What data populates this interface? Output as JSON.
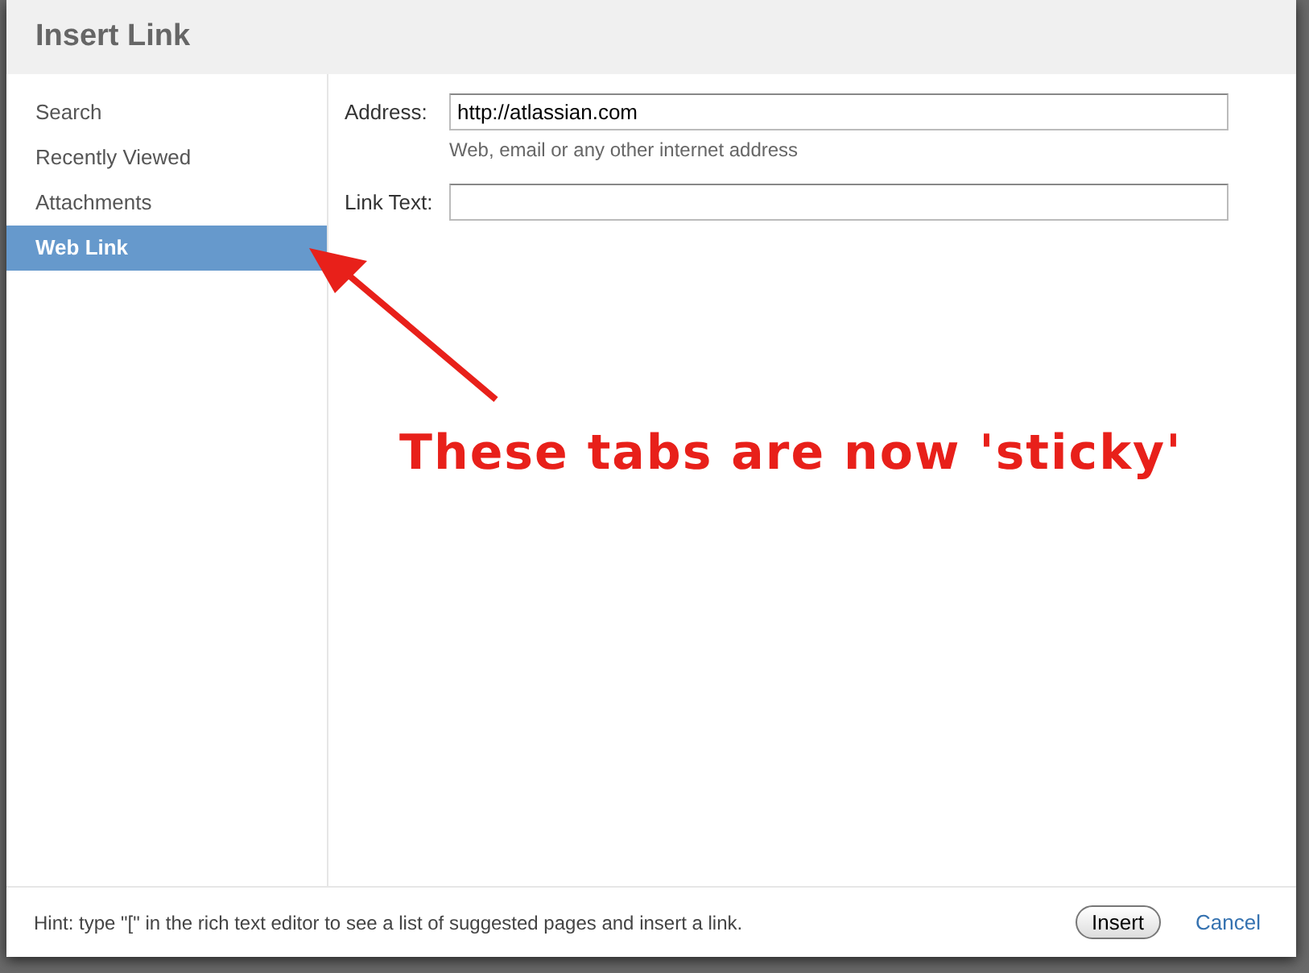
{
  "window": {
    "title": "Insert Link"
  },
  "tabs": [
    {
      "label": "Search",
      "selected": false
    },
    {
      "label": "Recently Viewed",
      "selected": false
    },
    {
      "label": "Attachments",
      "selected": false
    },
    {
      "label": "Web Link",
      "selected": true
    }
  ],
  "form": {
    "fields": [
      {
        "label": "Address:",
        "value": "http://atlassian.com",
        "help": "Web, email or any other internet address"
      },
      {
        "label": "Link Text:"
      }
    ]
  },
  "annotation": {
    "text": "These tabs are now 'sticky'"
  },
  "footer": {
    "hint": "Hint: type \"[\" in the rich text editor to see a list of suggested pages and insert a link.",
    "buttons": [
      {
        "label": "Insert",
        "kind": "button"
      },
      {
        "label": "Cancel",
        "kind": "link"
      }
    ]
  }
}
